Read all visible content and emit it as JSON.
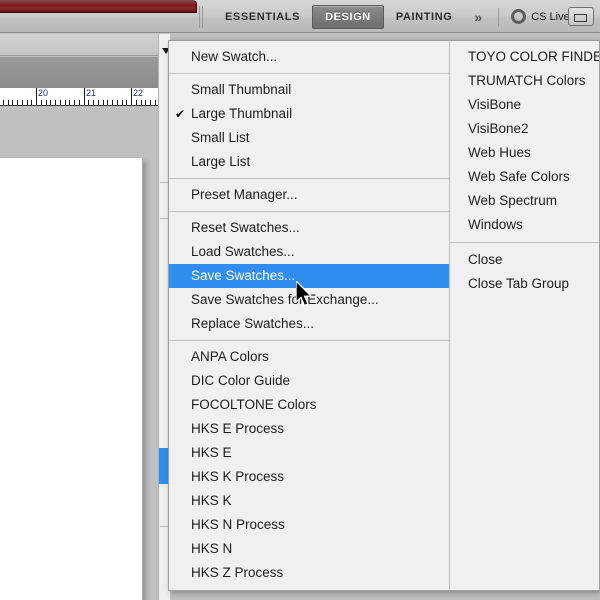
{
  "app_bar": {
    "workspace_tabs": [
      {
        "label": "ESSENTIALS",
        "active": false
      },
      {
        "label": "DESIGN",
        "active": true
      },
      {
        "label": "PAINTING",
        "active": false
      }
    ],
    "more_workspaces_label": "»",
    "cs_live_label": "CS Live",
    "icons": {
      "ring": "cs-live-ring-icon",
      "caret": "chevron-down-icon",
      "window": "restore-window-icon"
    }
  },
  "document": {
    "ruler": {
      "unit_labels": [
        "20",
        "21",
        "22"
      ],
      "label_positions": [
        36,
        84,
        131
      ]
    }
  },
  "menu": {
    "left_column": [
      {
        "label": "New Swatch...",
        "type": "item"
      },
      {
        "type": "separator"
      },
      {
        "label": "Small Thumbnail",
        "type": "item"
      },
      {
        "label": "Large Thumbnail",
        "type": "item",
        "checked": true
      },
      {
        "label": "Small List",
        "type": "item"
      },
      {
        "label": "Large List",
        "type": "item"
      },
      {
        "type": "separator"
      },
      {
        "label": "Preset Manager...",
        "type": "item"
      },
      {
        "type": "separator"
      },
      {
        "label": "Reset Swatches...",
        "type": "item"
      },
      {
        "label": "Load Swatches...",
        "type": "item"
      },
      {
        "label": "Save Swatches...",
        "type": "item",
        "selected": true
      },
      {
        "label": "Save Swatches for Exchange...",
        "type": "item"
      },
      {
        "label": "Replace Swatches...",
        "type": "item"
      },
      {
        "type": "separator"
      },
      {
        "label": "ANPA Colors",
        "type": "item"
      },
      {
        "label": "DIC Color Guide",
        "type": "item"
      },
      {
        "label": "FOCOLTONE Colors",
        "type": "item"
      },
      {
        "label": "HKS E Process",
        "type": "item"
      },
      {
        "label": "HKS E",
        "type": "item"
      },
      {
        "label": "HKS K Process",
        "type": "item"
      },
      {
        "label": "HKS K",
        "type": "item"
      },
      {
        "label": "HKS N Process",
        "type": "item"
      },
      {
        "label": "HKS N",
        "type": "item"
      },
      {
        "label": "HKS Z Process",
        "type": "item"
      }
    ],
    "right_column": [
      {
        "label": "TOYO COLOR FINDER",
        "type": "item"
      },
      {
        "label": "TRUMATCH Colors",
        "type": "item"
      },
      {
        "label": "VisiBone",
        "type": "item"
      },
      {
        "label": "VisiBone2",
        "type": "item"
      },
      {
        "label": "Web Hues",
        "type": "item"
      },
      {
        "label": "Web Safe Colors",
        "type": "item"
      },
      {
        "label": "Web Spectrum",
        "type": "item"
      },
      {
        "label": "Windows",
        "type": "item"
      },
      {
        "type": "separator"
      },
      {
        "label": "Close",
        "type": "item"
      },
      {
        "label": "Close Tab Group",
        "type": "item"
      }
    ],
    "check_glyph": "✔"
  },
  "colors": {
    "highlight": "#2f8ef0",
    "menu_bg": "#f0f0f0",
    "app_bar_bg": "#cccccc",
    "title_red": "#7d1b1d",
    "canvas_bg": "#c0c0c0"
  }
}
